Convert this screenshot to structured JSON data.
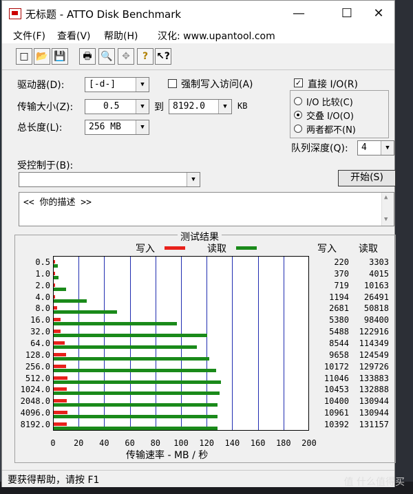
{
  "window": {
    "title": "无标题 - ATTO Disk Benchmark",
    "min": "—",
    "max": "☐",
    "close": "✕"
  },
  "menu": {
    "file": "文件(F)",
    "view": "查看(V)",
    "help": "帮助(H)",
    "hanhua": "汉化: www.upantool.com"
  },
  "toolbar": {
    "new_icon": "□",
    "open_icon": "📂",
    "save_icon": "💾",
    "print_icon": "🖶",
    "preview_icon": "🔍",
    "move_icon": "✥",
    "help_icon": "?",
    "whatis_icon": "↖?"
  },
  "settings": {
    "drive_label": "驱动器(D):",
    "drive_value": "[-d-]",
    "force_write_label": "强制写入访问(A)",
    "force_write_checked": false,
    "transfer_label": "传输大小(Z):",
    "transfer_from": "0.5",
    "to_label": "到",
    "transfer_to": "8192.0",
    "unit": "KB",
    "length_label": "总长度(L):",
    "length_value": "256 MB",
    "direct_io_label": "直接 I/O(R)",
    "direct_io_checked": true,
    "direct_io_check_mark": "✓",
    "io_compare": "I/O 比较(C)",
    "overlap_io": "交叠 I/O(O)",
    "neither": "两者都不(N)",
    "selected_io": "overlap",
    "queue_label": "队列深度(Q):",
    "queue_value": "4",
    "controlled_label": "受控制于(B):",
    "controlled_value": "",
    "start_button": "开始(S)",
    "description": "<<  你的描述   >>"
  },
  "results": {
    "title": "测试结果",
    "legend_write": "写入",
    "legend_read": "读取",
    "col_write": "写入",
    "col_read": "读取",
    "xlabel": "传输速率 - MB / 秒"
  },
  "chart_data": {
    "type": "bar",
    "orientation": "horizontal",
    "title": "测试结果",
    "xlabel": "传输速率 - MB / 秒",
    "xlim": [
      0,
      200
    ],
    "xticks": [
      "0",
      "20",
      "40",
      "60",
      "80",
      "100",
      "120",
      "140",
      "160",
      "180",
      "200"
    ],
    "categories": [
      "0.5",
      "1.0",
      "2.0",
      "4.0",
      "8.0",
      "16.0",
      "32.0",
      "64.0",
      "128.0",
      "256.0",
      "512.0",
      "1024.0",
      "2048.0",
      "4096.0",
      "8192.0"
    ],
    "series": [
      {
        "name": "写入",
        "color": "#e8211b",
        "values": [
          220,
          370,
          719,
          1194,
          2681,
          5380,
          5488,
          8544,
          9658,
          10172,
          11046,
          10453,
          10400,
          10961,
          10392
        ],
        "labels": [
          "220",
          "370",
          "719",
          "1194",
          "2681",
          "5380",
          "5488",
          "8544",
          "9658",
          "10172",
          "11046",
          "10453",
          "10400",
          "10961",
          "10392"
        ]
      },
      {
        "name": "读取",
        "color": "#1a8a1a",
        "values": [
          3303,
          4015,
          10163,
          26491,
          50818,
          98400,
          122916,
          114349,
          124549,
          129726,
          133883,
          132888,
          130944,
          130944,
          131157
        ],
        "labels": [
          "3303",
          "4015",
          "10163",
          "26491",
          "50818",
          "98400",
          "122916",
          "114349",
          "124549",
          "129726",
          "133883",
          "132888",
          "130944",
          "130944",
          "131157"
        ]
      }
    ],
    "value_unit": "KB/s",
    "grid": true
  },
  "status": {
    "text": "要获得帮助，请按 F1"
  },
  "watermark": "值 什么值得买"
}
